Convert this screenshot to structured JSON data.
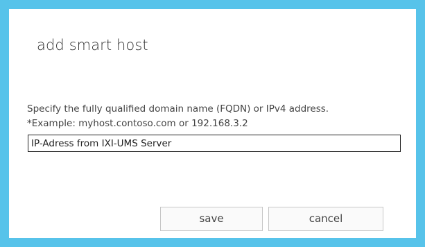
{
  "dialog": {
    "title": "add smart host",
    "description_line1": "Specify the fully qualified domain name (FQDN) or IPv4 address.",
    "description_line2": "*Example: myhost.contoso.com or 192.168.3.2",
    "input_value": "IP-Adress from IXI-UMS Server",
    "save_label": "save",
    "cancel_label": "cancel"
  },
  "colors": {
    "frame": "#57c3ea",
    "background": "#ffffff",
    "text": "#444444"
  }
}
